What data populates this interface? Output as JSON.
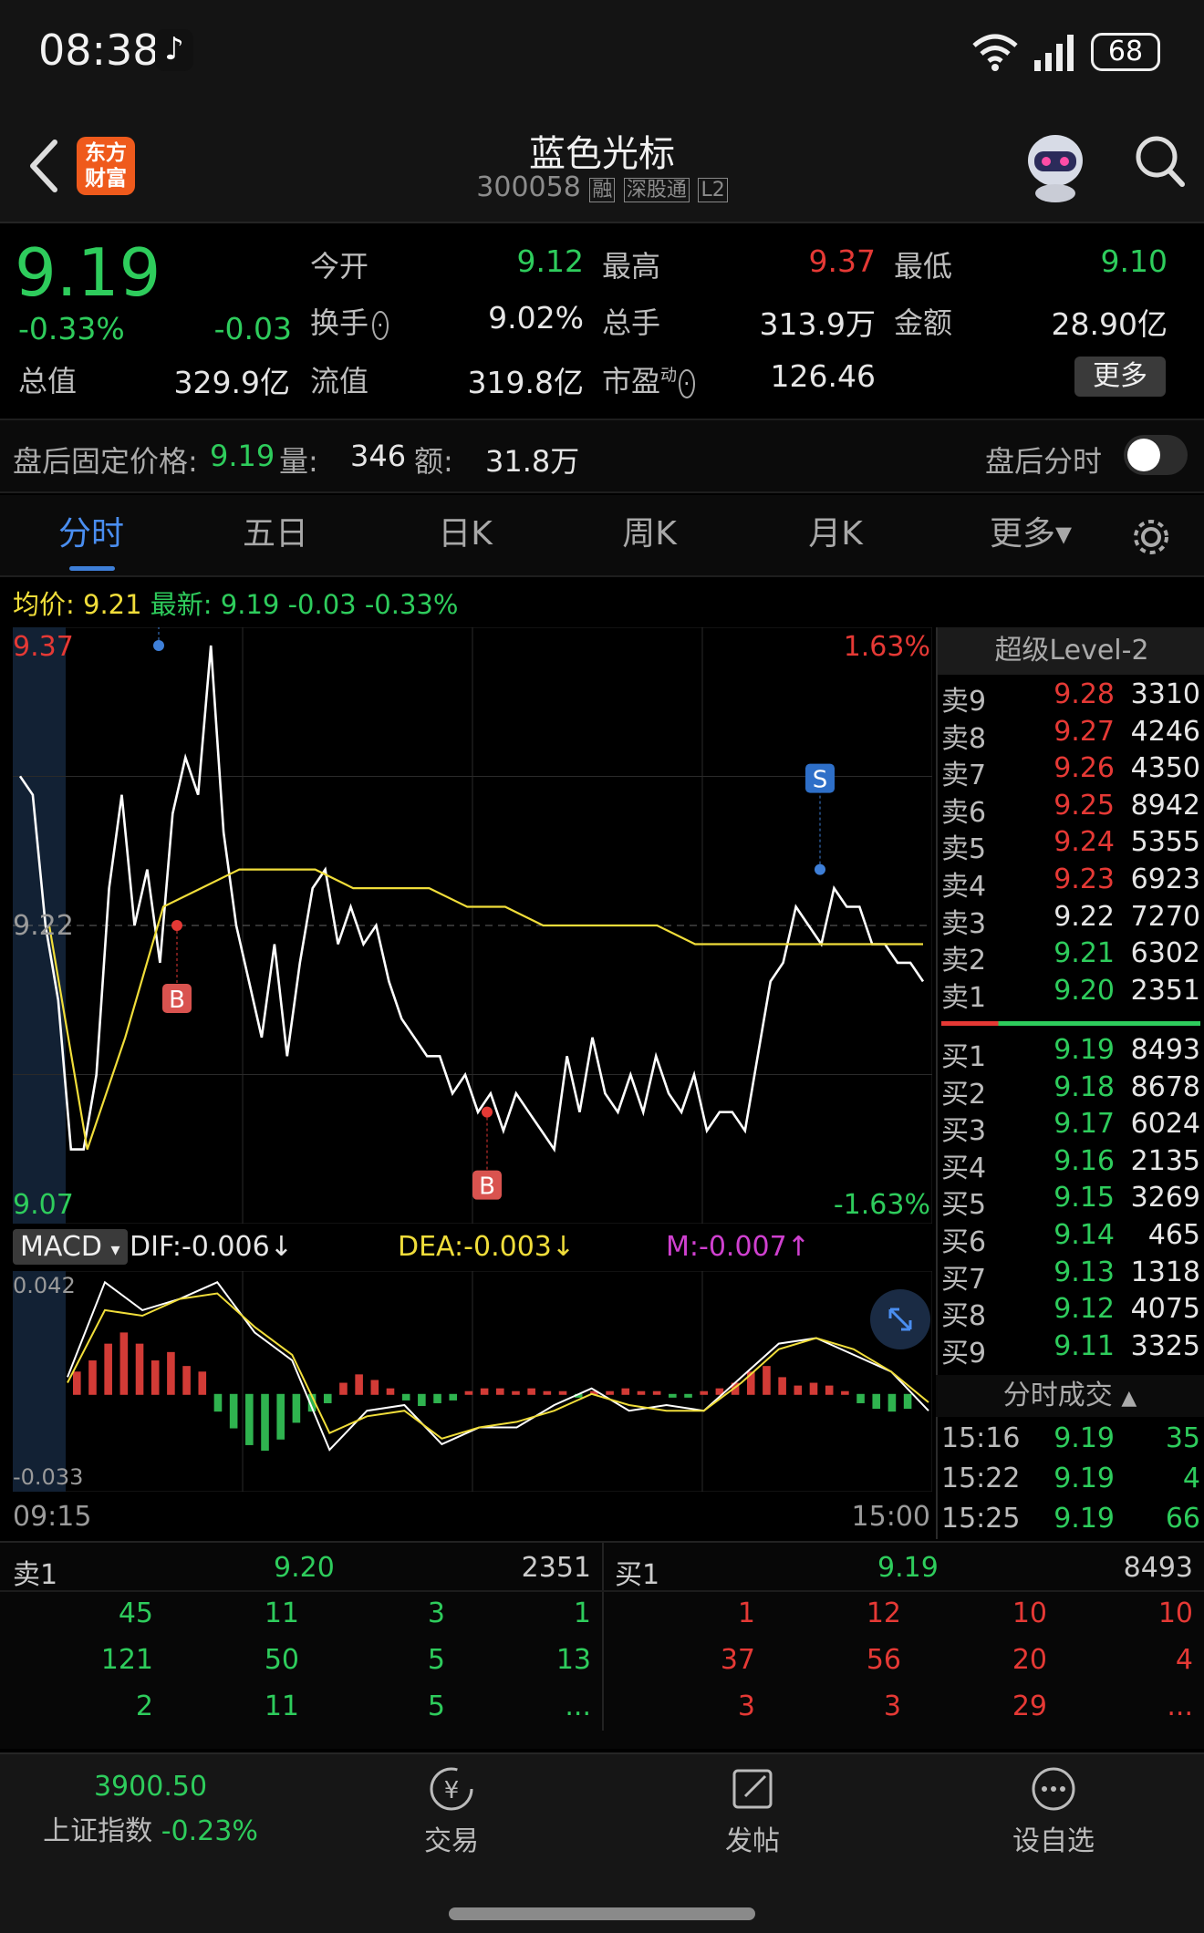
{
  "status_bar": {
    "time": "08:38",
    "battery": "68"
  },
  "header": {
    "stock_name": "蓝色光标",
    "code": "300058",
    "tags": [
      "融",
      "深股通",
      "L2"
    ],
    "logo_text": [
      "东方",
      "财富"
    ]
  },
  "quote": {
    "price": "9.19",
    "change_pct": "-0.33%",
    "change": "-0.03",
    "open_label": "今开",
    "open": "9.12",
    "high_label": "最高",
    "high": "9.37",
    "low_label": "最低",
    "low": "9.10",
    "turnover_label": "换手",
    "turnover": "9.02%",
    "volume_label": "总手",
    "volume": "313.9万",
    "amount_label": "金额",
    "amount": "28.90亿",
    "mktcap_label": "总值",
    "mktcap": "329.9亿",
    "float_label": "流值",
    "float_cap": "319.8亿",
    "pe_label": "市盈",
    "pe_sup": "动",
    "pe": "126.46",
    "more_label": "更多"
  },
  "after_hours": {
    "price_label": "盘后固定价格:",
    "price": "9.19",
    "vol_label": "量:",
    "vol": "346",
    "amt_label": "额:",
    "amt": "31.8万",
    "toggle_label": "盘后分时"
  },
  "tabs": [
    "分时",
    "五日",
    "日K",
    "周K",
    "月K",
    "更多▾"
  ],
  "chart_info": {
    "avg_label": "均价:",
    "avg": "9.21",
    "latest_label": "最新:",
    "latest": "9.19 -0.03 -0.33%"
  },
  "chart_data": {
    "type": "line",
    "price_axis": {
      "top": "9.37",
      "mid": "9.22",
      "bottom": "9.07",
      "top_pct": "1.63%",
      "bottom_pct": "-1.63%"
    },
    "ylim": [
      9.07,
      9.37
    ],
    "x_labels": [
      "09:15",
      "15:00"
    ],
    "series": [
      {
        "name": "最新",
        "color": "#ffffff",
        "values": [
          9.3,
          9.29,
          9.22,
          9.18,
          9.1,
          9.1,
          9.14,
          9.24,
          9.29,
          9.22,
          9.25,
          9.2,
          9.28,
          9.31,
          9.29,
          9.37,
          9.27,
          9.22,
          9.19,
          9.16,
          9.21,
          9.15,
          9.2,
          9.24,
          9.25,
          9.21,
          9.23,
          9.21,
          9.22,
          9.19,
          9.17,
          9.16,
          9.15,
          9.15,
          9.13,
          9.14,
          9.12,
          9.13,
          9.11,
          9.13,
          9.12,
          9.11,
          9.1,
          9.15,
          9.12,
          9.16,
          9.13,
          9.12,
          9.14,
          9.12,
          9.15,
          9.13,
          9.12,
          9.14,
          9.11,
          9.12,
          9.12,
          9.11,
          9.15,
          9.19,
          9.2,
          9.23,
          9.22,
          9.21,
          9.24,
          9.23,
          9.23,
          9.21,
          9.21,
          9.2,
          9.2,
          9.19
        ]
      },
      {
        "name": "均价",
        "color": "#f0dd3a",
        "values": [
          9.22,
          9.1,
          9.16,
          9.23,
          9.24,
          9.25,
          9.25,
          9.25,
          9.24,
          9.24,
          9.24,
          9.23,
          9.23,
          9.22,
          9.22,
          9.22,
          9.22,
          9.21,
          9.21,
          9.21,
          9.21,
          9.21,
          9.21,
          9.21
        ]
      }
    ],
    "markers": [
      {
        "type": "S",
        "price": 9.37
      },
      {
        "type": "B",
        "price": 9.22
      },
      {
        "type": "B",
        "price": 9.12
      },
      {
        "type": "S",
        "price": 9.25
      }
    ],
    "title": "",
    "xlabel": "",
    "ylabel": "",
    "grid": true
  },
  "macd": {
    "label": "MACD",
    "dif": "DIF:-0.006↓",
    "dea": "DEA:-0.003↓",
    "m": "M:-0.007↑",
    "top": "0.042",
    "bottom": "-0.033",
    "hist": [
      0.008,
      0.012,
      0.018,
      0.022,
      0.018,
      0.012,
      0.015,
      0.01,
      0.008,
      -0.006,
      -0.012,
      -0.018,
      -0.02,
      -0.016,
      -0.01,
      -0.006,
      -0.003,
      0.004,
      0.007,
      0.005,
      0.002,
      -0.002,
      -0.004,
      -0.003,
      -0.002,
      0.001,
      0.002,
      0.002,
      0.001,
      0.002,
      0.001,
      0.001,
      -0.001,
      0.001,
      0.001,
      0.002,
      0.001,
      0.001,
      -0.001,
      -0.001,
      0.001,
      0.002,
      0.004,
      0.008,
      0.01,
      0.006,
      0.003,
      0.004,
      0.003,
      0.001,
      -0.003,
      -0.005,
      -0.006,
      -0.005
    ],
    "dif_line": [
      0.006,
      0.04,
      0.03,
      0.034,
      0.04,
      0.022,
      0.012,
      -0.02,
      -0.006,
      -0.004,
      -0.018,
      -0.012,
      -0.012,
      -0.004,
      0.002,
      -0.006,
      -0.004,
      -0.006,
      0.006,
      0.018,
      0.02,
      0.014,
      0.008,
      -0.006
    ],
    "dea_line": [
      0.004,
      0.03,
      0.028,
      0.034,
      0.036,
      0.024,
      0.014,
      -0.014,
      -0.008,
      -0.006,
      -0.016,
      -0.012,
      -0.01,
      -0.006,
      0.0,
      -0.004,
      -0.006,
      -0.006,
      0.004,
      0.016,
      0.02,
      0.016,
      0.008,
      -0.003
    ]
  },
  "order_book": {
    "title": "超级Level-2",
    "asks": [
      {
        "label": "卖9",
        "price": "9.28",
        "vol": "3310"
      },
      {
        "label": "卖8",
        "price": "9.27",
        "vol": "4246"
      },
      {
        "label": "卖7",
        "price": "9.26",
        "vol": "4350"
      },
      {
        "label": "卖6",
        "price": "9.25",
        "vol": "8942"
      },
      {
        "label": "卖5",
        "price": "9.24",
        "vol": "5355"
      },
      {
        "label": "卖4",
        "price": "9.23",
        "vol": "6923"
      },
      {
        "label": "卖3",
        "price": "9.22",
        "vol": "7270"
      },
      {
        "label": "卖2",
        "price": "9.21",
        "vol": "6302"
      },
      {
        "label": "卖1",
        "price": "9.20",
        "vol": "2351"
      }
    ],
    "bids": [
      {
        "label": "买1",
        "price": "9.19",
        "vol": "8493"
      },
      {
        "label": "买2",
        "price": "9.18",
        "vol": "8678"
      },
      {
        "label": "买3",
        "price": "9.17",
        "vol": "6024"
      },
      {
        "label": "买4",
        "price": "9.16",
        "vol": "2135"
      },
      {
        "label": "买5",
        "price": "9.15",
        "vol": "3269"
      },
      {
        "label": "买6",
        "price": "9.14",
        "vol": "465"
      },
      {
        "label": "买7",
        "price": "9.13",
        "vol": "1318"
      },
      {
        "label": "买8",
        "price": "9.12",
        "vol": "4075"
      },
      {
        "label": "买9",
        "price": "9.11",
        "vol": "3325"
      }
    ],
    "trades_title": "分时成交",
    "trades": [
      {
        "time": "15:16",
        "price": "9.19",
        "vol": "35"
      },
      {
        "time": "15:22",
        "price": "9.19",
        "vol": "4"
      },
      {
        "time": "15:25",
        "price": "9.19",
        "vol": "66"
      }
    ]
  },
  "queue": {
    "ask_label": "卖1",
    "ask_price": "9.20",
    "ask_vol": "2351",
    "bid_label": "买1",
    "bid_price": "9.19",
    "bid_vol": "8493",
    "ask_rows": [
      [
        "45",
        "11",
        "3",
        "1"
      ],
      [
        "121",
        "50",
        "5",
        "13"
      ],
      [
        "2",
        "11",
        "5",
        "..."
      ]
    ],
    "bid_rows": [
      [
        "1",
        "12",
        "10",
        "10"
      ],
      [
        "37",
        "56",
        "20",
        "4"
      ],
      [
        "3",
        "3",
        "29",
        "..."
      ]
    ]
  },
  "bottom_nav": {
    "index_value": "3900.50",
    "index_label": "上证指数",
    "index_change": "-0.23%",
    "trade": "交易",
    "post": "发帖",
    "watch": "设自选"
  },
  "colors": {
    "up": "#e53935",
    "down": "#2ecc5c",
    "accent": "#3e7fd8",
    "avg_line": "#f0dd3a"
  }
}
